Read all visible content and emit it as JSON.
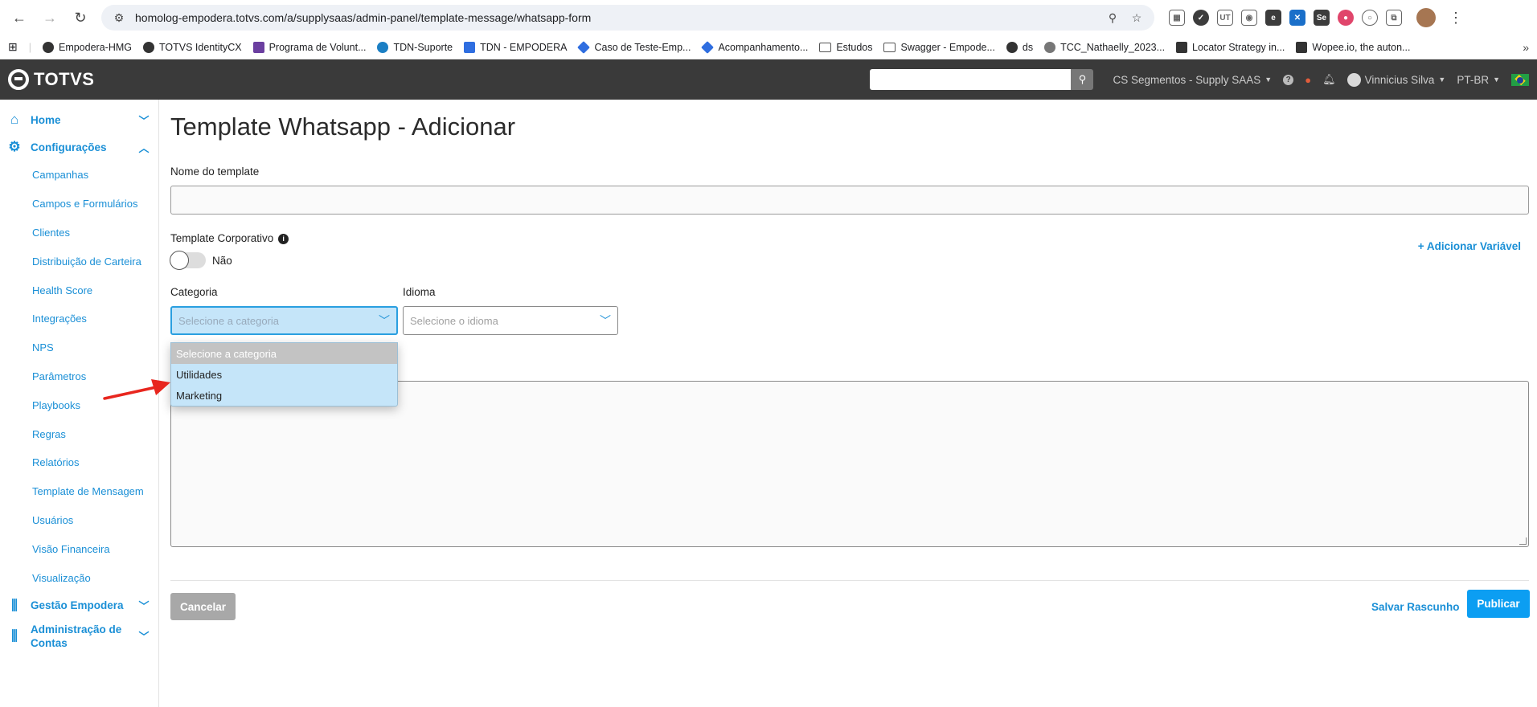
{
  "browser": {
    "url": "homolog-empodera.totvs.com/a/supplysaas/admin-panel/template-message/whatsapp-form",
    "bookmarks": [
      "Empodera-HMG",
      "TOTVS IdentityCX",
      "Programa de Volunt...",
      "TDN-Suporte",
      "TDN - EMPODERA",
      "Caso de Teste-Emp...",
      "Acompanhamento...",
      "Estudos",
      "Swagger - Empode...",
      "ds",
      "TCC_Nathaelly_2023...",
      "Locator Strategy in...",
      "Wopee.io, the auton..."
    ]
  },
  "header": {
    "logo_text": "TOTVS",
    "segment": "CS Segmentos - Supply SAAS",
    "user": "Vinnicius Silva",
    "language": "PT-BR"
  },
  "sidebar": {
    "home": "Home",
    "config": "Configurações",
    "items": [
      "Campanhas",
      "Campos e Formulários",
      "Clientes",
      "Distribuição de Carteira",
      "Health Score",
      "Integrações",
      "NPS",
      "Parâmetros",
      "Playbooks",
      "Regras",
      "Relatórios",
      "Template de Mensagem",
      "Usuários",
      "Visão Financeira",
      "Visualização"
    ],
    "gestao": "Gestão Empodera",
    "admin": "Administração de Contas"
  },
  "form": {
    "title": "Template Whatsapp - Adicionar",
    "name_label": "Nome do template",
    "corporate_label": "Template Corporativo",
    "toggle_value": "Não",
    "add_variable": "+ Adicionar Variável",
    "category_label": "Categoria",
    "category_placeholder": "Selecione a categoria",
    "language_label": "Idioma",
    "language_placeholder": "Selecione o idioma",
    "category_options": [
      "Selecione a categoria",
      "Utilidades",
      "Marketing"
    ],
    "cancel": "Cancelar",
    "save_draft": "Salvar Rascunho",
    "publish": "Publicar"
  },
  "colors": {
    "accent": "#1a8fd6",
    "header_bg": "#3a3a3a",
    "publish_bg": "#0c9ef2",
    "annotation_arrow": "#e8261e"
  }
}
